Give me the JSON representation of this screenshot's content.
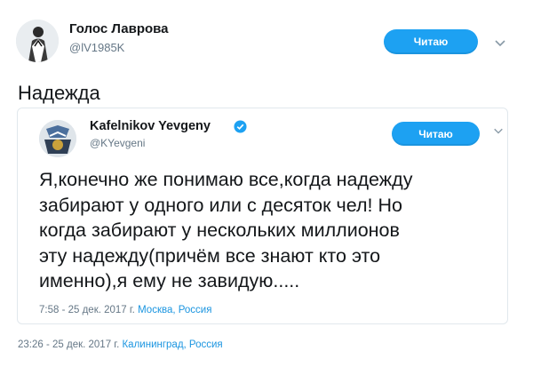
{
  "tweet": {
    "author": {
      "name": "Голос Лаврова",
      "handle": "@lV1985K"
    },
    "follow_label": "Читаю",
    "text": "Надежда",
    "meta": {
      "time_date": "23:26 - 25 дек. 2017 г.",
      "location": "Калининград, Россия"
    }
  },
  "quoted": {
    "author": {
      "name": "Kafelnikov Yevgeny",
      "handle": "@KYevgeni"
    },
    "follow_label": "Читаю",
    "text": "Я,конечно же понимаю все,когда надежду\nзабирают у одного или с десяток чел! Но\nкогда забирают у нескольких миллионов\nэту надежду(причём все знают кто это\nименно),я ему не завидую.....",
    "meta": {
      "time_date": "7:58 - 25 дек. 2017 г.",
      "location": "Москва, Россия"
    }
  },
  "icons": {
    "verified": "verified-badge-icon",
    "chevron": "chevron-down-icon"
  },
  "colors": {
    "accent": "#1da1f2",
    "link": "#1b95e0",
    "muted": "#657786",
    "text": "#14171a"
  }
}
